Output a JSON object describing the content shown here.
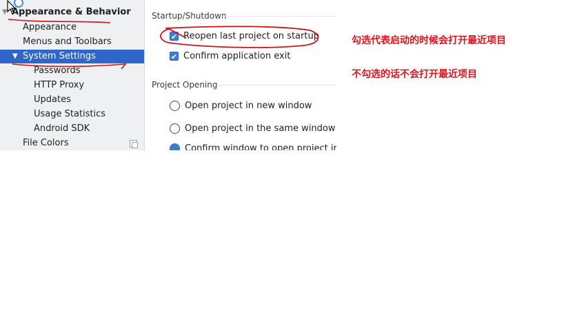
{
  "sidebar": {
    "items": [
      {
        "label": "Appearance & Behavior",
        "arrow": "▼"
      },
      {
        "label": "Appearance"
      },
      {
        "label": "Menus and Toolbars"
      },
      {
        "label": "System Settings",
        "arrow": "▼"
      },
      {
        "label": "Passwords"
      },
      {
        "label": "HTTP Proxy"
      },
      {
        "label": "Updates"
      },
      {
        "label": "Usage Statistics"
      },
      {
        "label": "Android SDK"
      },
      {
        "label": "File Colors"
      }
    ],
    "selected_item": "System Settings"
  },
  "startup": {
    "title": "Startup/Shutdown",
    "reopen_label": "Reopen last project on startup",
    "reopen_checked": true,
    "confirm_exit_label": "Confirm application exit",
    "confirm_exit_checked": true
  },
  "project_opening": {
    "title": "Project Opening",
    "options": [
      {
        "label": "Open project in new window",
        "selected": false
      },
      {
        "label": "Open project in the same window",
        "selected": false
      },
      {
        "label": "Confirm window to open project in",
        "selected": true
      }
    ]
  },
  "annotations": {
    "note_checked": "勾选代表启动的时候会打开最近项目",
    "note_unchecked": "不勾选的话不会打开最近项目"
  },
  "colors": {
    "selection": "#2f66c9",
    "annotation_red": "#e0141e",
    "checkbox_blue": "#3a7fd5"
  },
  "icons": [
    "cursor-icon",
    "copy-icon",
    "tree-arrow-icon"
  ]
}
